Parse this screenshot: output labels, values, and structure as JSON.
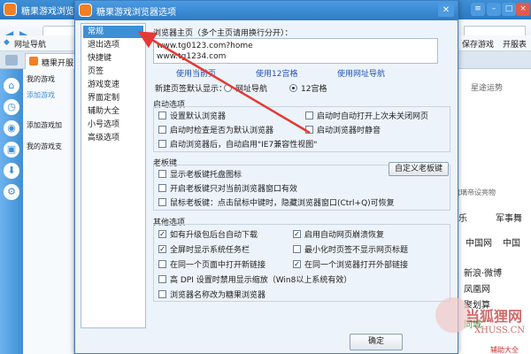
{
  "browser": {
    "title": "糖果游戏浏览器",
    "bookmark_nav": "网址导航",
    "tab_label": "糖果开服",
    "bm_save": "保存游戏",
    "bm_open": "开服表",
    "side_my_games": "我的游戏",
    "side_add_game": "添加游戏",
    "side_add_prompt": "添加游戏加",
    "side_my_games_hint": "我的游戏支",
    "right_page": [
      "星途运势",
      "琉璃帝设亮物",
      "娱乐",
      "军事舞",
      "中国网",
      "中国",
      "新浪·微博",
      "凤凰网",
      "聚划算",
      "同城",
      "辅助大全"
    ]
  },
  "dialog": {
    "title": "糖果游戏浏览器选项",
    "close_icon": "✕",
    "nav_items": [
      "常规",
      "退出选项",
      "快捷键",
      "页签",
      "游戏变速",
      "界面定制",
      "辅助大全",
      "小号选项",
      "高级选项"
    ],
    "selected_nav": "常规",
    "homepage_label": "浏览器主页（多个主页请用换行分开）：",
    "homepage_lines": [
      "www.tg0123.com?home",
      "www.tg1234.com"
    ],
    "link_current": "使用当前页",
    "link_12grid": "使用12宫格",
    "link_nav": "使用网址导航",
    "newtab_label": "新建页签默认显示：",
    "newtab_opt1": "网址导航",
    "newtab_opt2": "12宫格",
    "startup_title": "启动选项",
    "startup_opts": [
      "设置默认浏览器",
      "启动时自动打开上次未关闭网页",
      "启动时检查是否为默认浏览器",
      "启动浏览器时静音",
      "启动浏览器后，自动启用\"IE7兼容性视图\""
    ],
    "boss_title": "老板键",
    "boss_opts": [
      "显示老板键托盘图标",
      "开启老板键只对当前浏览器窗口有效",
      "鼠标老板键：点击鼠标中键时，隐藏浏览器窗口(Ctrl+Q)可恢复"
    ],
    "boss_btn": "自定义老板键",
    "other_title": "其他选项",
    "other_opts": [
      "如有升级包后台自动下载",
      "启用自动网页崩溃恢复",
      "全屏时显示系统任务栏",
      "最小化时页签不显示网页标题",
      "在同一个页面中打开新链接",
      "在同一个浏览器打开外部链接",
      "高 DPI 设置时禁用显示缩放（Win8以上系统有效）",
      "浏览器名称改为糖果浏览器"
    ],
    "ok_button": "确定"
  },
  "watermark": {
    "big": "当狐狸网",
    "small": "XHUSS.CN"
  },
  "colors": {
    "accent": "#3d8fd6",
    "arrow": "#e53935"
  }
}
